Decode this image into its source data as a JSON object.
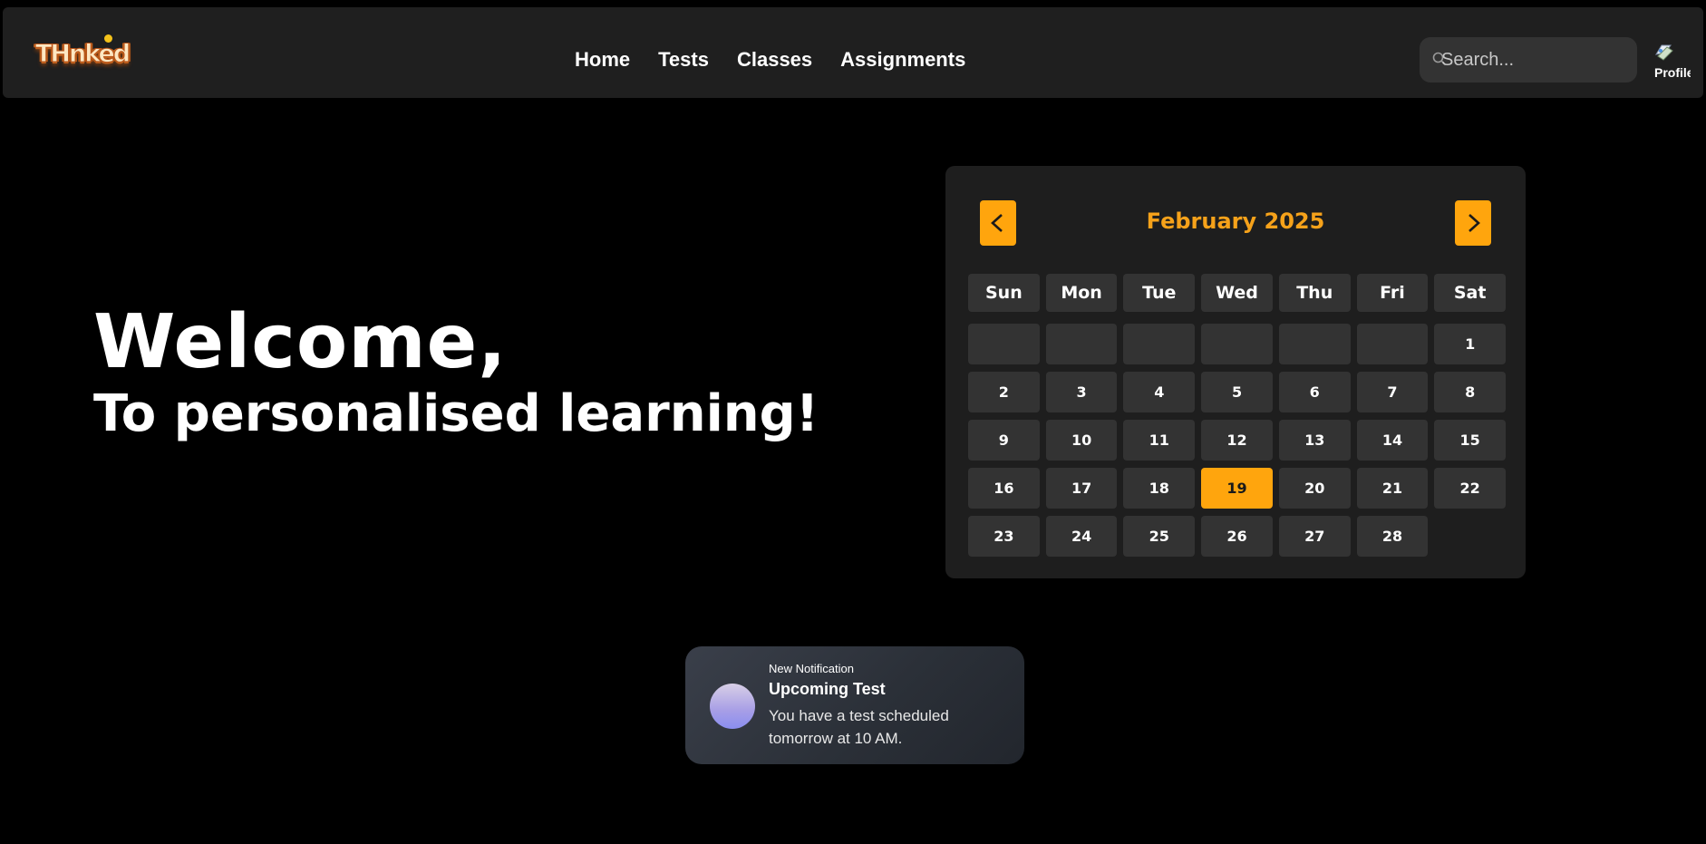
{
  "app": {
    "logo_text": "THnked"
  },
  "nav": {
    "links": [
      "Home",
      "Tests",
      "Classes",
      "Assignments"
    ]
  },
  "search": {
    "placeholder": "Search..."
  },
  "profile": {
    "avatar_alt": "Profile"
  },
  "hero": {
    "title": "Welcome,",
    "subtitle": "To personalised learning!"
  },
  "calendar": {
    "month_label": "February 2025",
    "weekdays": [
      "Sun",
      "Mon",
      "Tue",
      "Wed",
      "Thu",
      "Fri",
      "Sat"
    ],
    "weeks": [
      [
        "",
        "",
        "",
        "",
        "",
        "",
        "1"
      ],
      [
        "2",
        "3",
        "4",
        "5",
        "6",
        "7",
        "8"
      ],
      [
        "9",
        "10",
        "11",
        "12",
        "13",
        "14",
        "15"
      ],
      [
        "16",
        "17",
        "18",
        "19",
        "20",
        "21",
        "22"
      ],
      [
        "23",
        "24",
        "25",
        "26",
        "27",
        "28",
        null
      ]
    ],
    "highlighted_day": "19",
    "accent_color": "#ffa50d"
  },
  "notification": {
    "kicker": "New Notification",
    "title": "Upcoming Test",
    "body": "You have a test scheduled tomorrow at 10 AM."
  },
  "colors": {
    "background": "#000000",
    "navbar": "#1f1f1f",
    "accent": "#ffa50d",
    "calendar_title": "#f6a21a",
    "cell": "#333333"
  },
  "icons": {
    "search": "search-icon",
    "prev": "chevron-left-icon",
    "next": "chevron-right-icon"
  }
}
